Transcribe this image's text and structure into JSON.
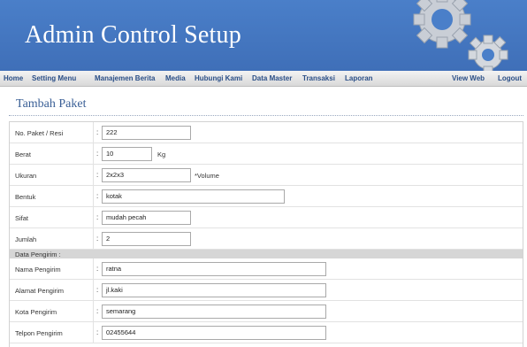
{
  "header": {
    "title": "Admin Control Setup",
    "brand_color": "#4a7fc9",
    "decoration_icon": "gears-icon"
  },
  "nav": {
    "items": [
      "Home",
      "Setting Menu",
      "Manajemen Berita",
      "Media",
      "Hubungi Kami",
      "Data Master",
      "Transaksi",
      "Laporan"
    ],
    "right_items": [
      "View Web",
      "Logout"
    ],
    "text_color": "#2b4f87"
  },
  "page": {
    "title": "Tambah Paket"
  },
  "form": {
    "no_paket": {
      "label": "No. Paket / Resi",
      "value": "222"
    },
    "berat": {
      "label": "Berat",
      "value": "10",
      "unit": "Kg"
    },
    "ukuran": {
      "label": "Ukuran",
      "value": "2x2x3",
      "note": "*Volume"
    },
    "bentuk": {
      "label": "Bentuk",
      "value": "kotak"
    },
    "sifat": {
      "label": "Sifat",
      "value": "mudah pecah"
    },
    "jumlah": {
      "label": "Jumlah",
      "value": "2"
    },
    "section_pengirim": "Data Pengirim :",
    "nama_pengirim": {
      "label": "Nama Pengirim",
      "value": "ratna"
    },
    "alamat_pengirim": {
      "label": "Alamat Pengirim",
      "value": "jl.kaki"
    },
    "kota_pengirim": {
      "label": "Kota Pengirim",
      "value": "semarang"
    },
    "telpon_pengirim": {
      "label": "Telpon Pengirim",
      "value": "02455644"
    },
    "colon": ":"
  }
}
